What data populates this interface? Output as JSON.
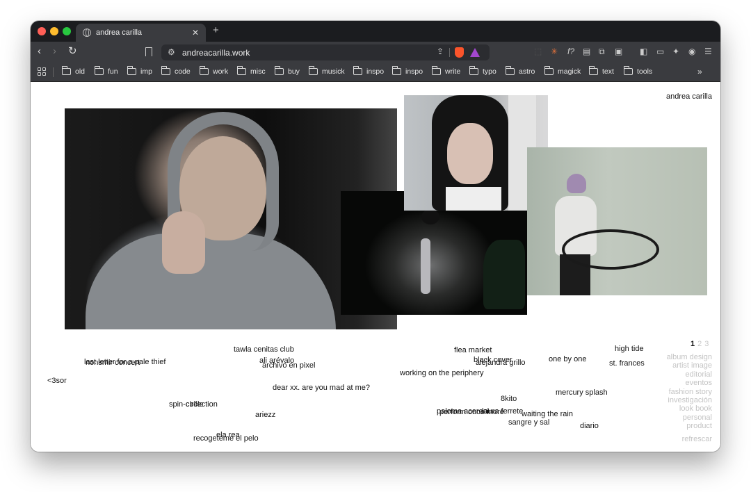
{
  "browser": {
    "tab_title": "andrea carilla",
    "url": "andreacarilla.work",
    "bookmarks": [
      "old",
      "fun",
      "imp",
      "code",
      "work",
      "misc",
      "buy",
      "musick",
      "inspo",
      "inspo",
      "write",
      "typo",
      "astro",
      "magick",
      "text",
      "tools"
    ]
  },
  "page": {
    "site_title": "andrea carilla",
    "pages": [
      "1",
      "2",
      "3"
    ],
    "categories": [
      "album design",
      "artist image",
      "editorial",
      "eventos",
      "fashion story",
      "investigación",
      "look book",
      "personal",
      "product"
    ],
    "refresh_label": "refrescar",
    "words": [
      "tawla cenitas club",
      "last letter for a pale thief",
      "nonsmir concert",
      "ali arévalo",
      "archivo en pixel",
      "<3sor",
      "dear xx. are you mad at me?",
      "spin-circle",
      "collection",
      "ariezz",
      "ela rea",
      "recogeteme el pelo",
      "flea market",
      "black cover",
      "alejandra grillo",
      "working on the periphery",
      "one by one",
      "high tide",
      "st. frances",
      "mercury splash",
      "8kito",
      "paloma acereal",
      "perform once more",
      "laura ferrete",
      "waiting the rain",
      "sangre y sal",
      "diario"
    ]
  }
}
